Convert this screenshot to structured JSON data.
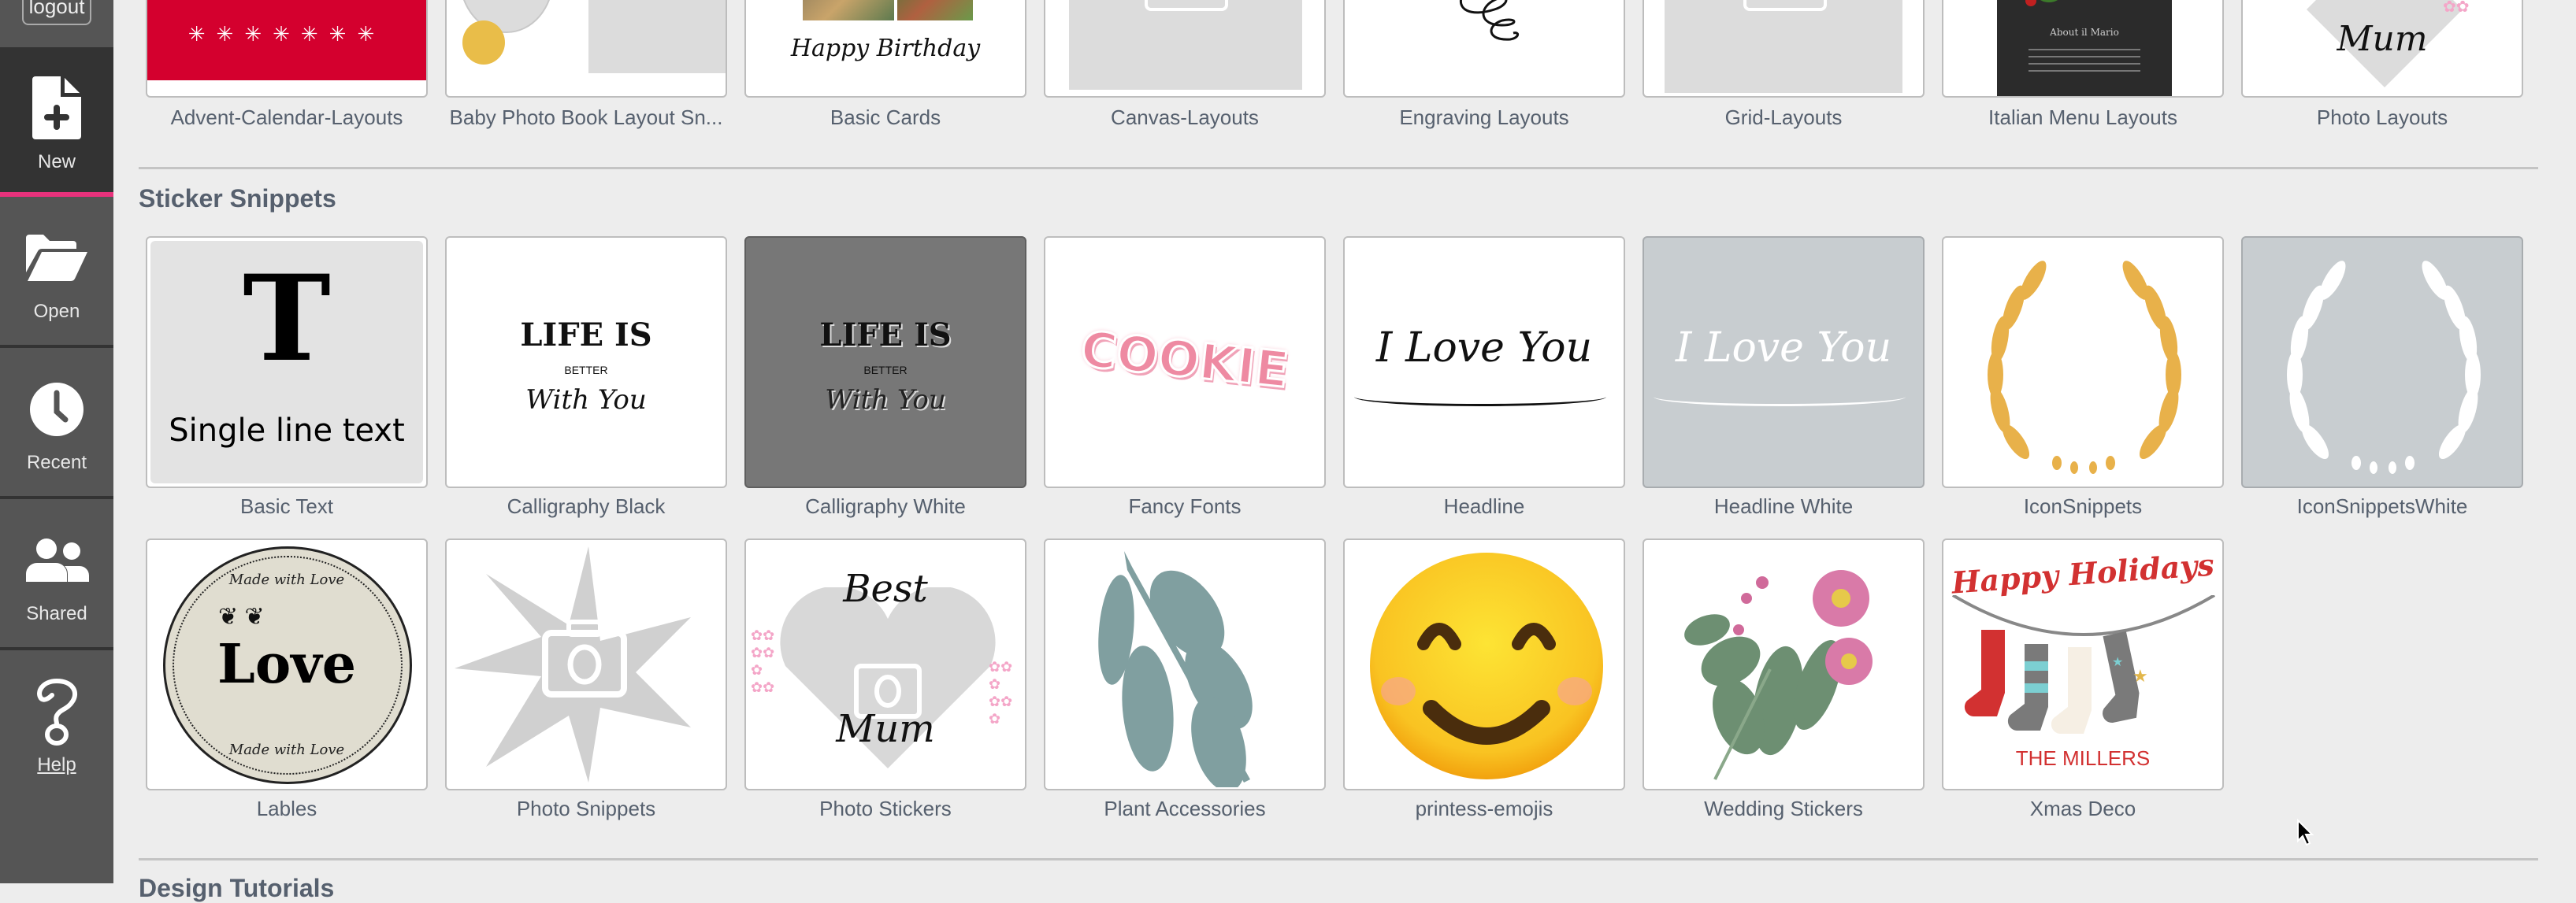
{
  "sidebar": {
    "logout_label": "logout",
    "items": [
      {
        "label": "New",
        "icon": "new-file-icon",
        "active": true
      },
      {
        "label": "Open",
        "icon": "folder-open-icon",
        "active": false
      },
      {
        "label": "Recent",
        "icon": "clock-icon",
        "active": false
      },
      {
        "label": "Shared",
        "icon": "users-icon",
        "active": false
      },
      {
        "label": "Help",
        "icon": "question-icon",
        "active": false
      }
    ],
    "accent_color": "#e8327c"
  },
  "layout_snippets": {
    "items": [
      {
        "label": "Advent-Calendar-Layouts"
      },
      {
        "label": "Baby Photo Book Layout Sn..."
      },
      {
        "label": "Basic Cards",
        "thumb_text": "Happy Birthday"
      },
      {
        "label": "Canvas-Layouts"
      },
      {
        "label": "Engraving Layouts"
      },
      {
        "label": "Grid-Layouts"
      },
      {
        "label": "Italian Menu Layouts",
        "thumb_text": "About il Mario"
      },
      {
        "label": "Photo Layouts",
        "thumb_text": "Mum"
      }
    ]
  },
  "sticker_snippets": {
    "title": "Sticker Snippets",
    "items": [
      {
        "label": "Basic Text",
        "thumb_text": "Single line text",
        "thumb_glyph": "T"
      },
      {
        "label": "Calligraphy Black",
        "thumb_lines": [
          "LIFE IS",
          "BETTER",
          "With You"
        ]
      },
      {
        "label": "Calligraphy White",
        "thumb_lines": [
          "LIFE IS",
          "BETTER",
          "With You"
        ]
      },
      {
        "label": "Fancy Fonts",
        "thumb_text": "COOKIE"
      },
      {
        "label": "Headline",
        "thumb_text": "I Love You"
      },
      {
        "label": "Headline White",
        "thumb_text": "I Love You"
      },
      {
        "label": "IconSnippets"
      },
      {
        "label": "IconSnippetsWhite"
      },
      {
        "label": "Lables",
        "thumb_lines": [
          "Made with Love",
          "Love",
          "Made with Love"
        ]
      },
      {
        "label": "Photo Snippets"
      },
      {
        "label": "Photo Stickers",
        "thumb_lines": [
          "Best",
          "Mum"
        ]
      },
      {
        "label": "Plant Accessories"
      },
      {
        "label": "printess-emojis"
      },
      {
        "label": "Wedding Stickers"
      },
      {
        "label": "Xmas Deco",
        "thumb_lines": [
          "Happy Holidays",
          "THE MILLERS"
        ]
      }
    ]
  },
  "next_section": {
    "title": "Design Tutorials"
  }
}
